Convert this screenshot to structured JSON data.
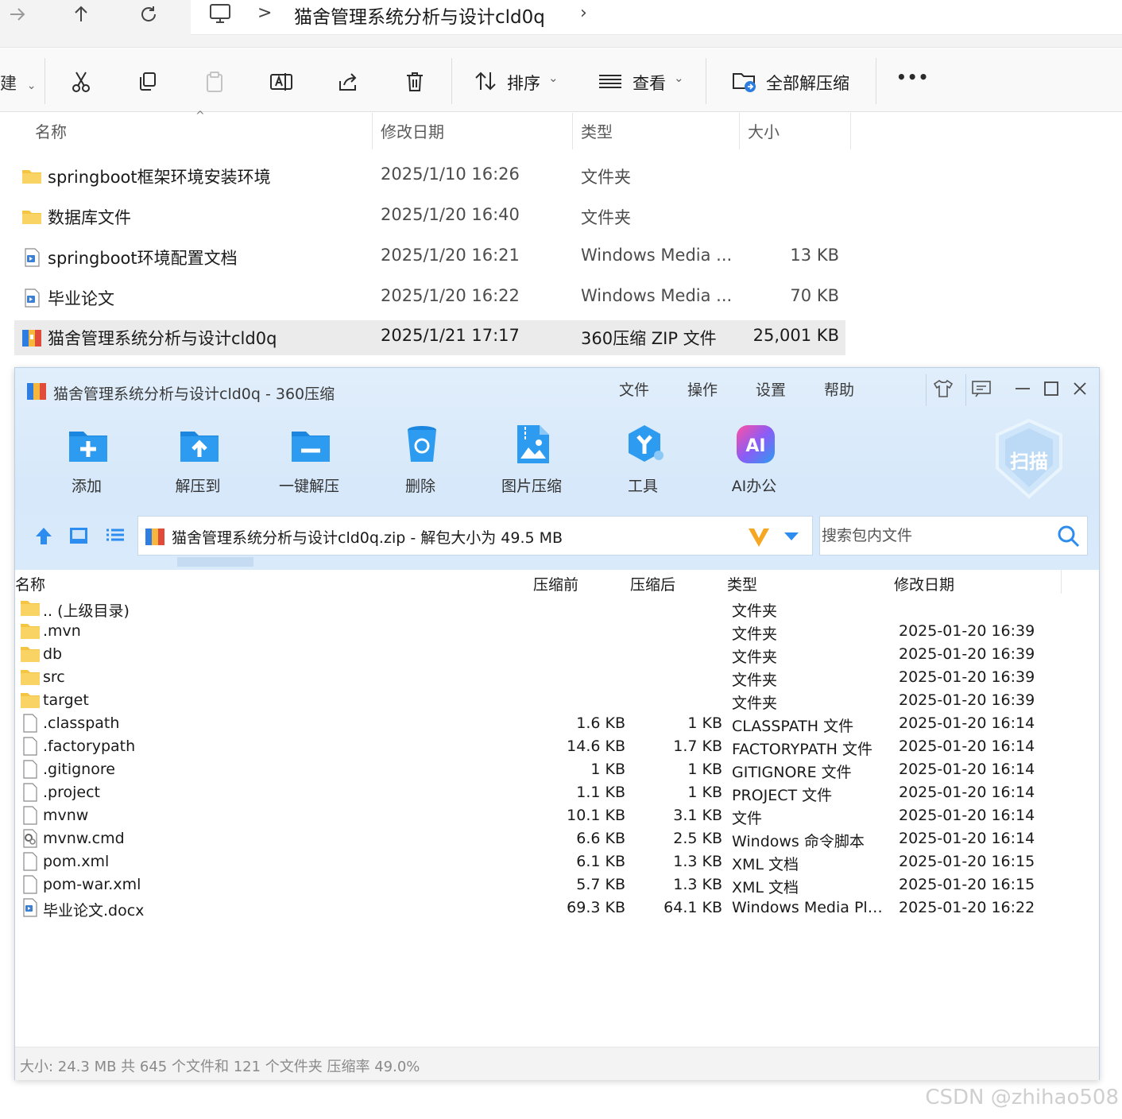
{
  "explorer": {
    "address": {
      "path": "猫舍管理系统分析与设计cld0q",
      "separator": ">",
      "more": "›"
    },
    "toolbar": {
      "new_partial": "建",
      "sort_label": "排序",
      "view_label": "查看",
      "extract_all_label": "全部解压缩",
      "more_label": "•••"
    },
    "columns": {
      "name": "名称",
      "date": "修改日期",
      "type": "类型",
      "size": "大小"
    },
    "rows": [
      {
        "name": "springboot框架环境安装环境",
        "date": "2025/1/10 16:26",
        "type": "文件夹",
        "size": "",
        "icon": "folder-icon"
      },
      {
        "name": "数据库文件",
        "date": "2025/1/20 16:40",
        "type": "文件夹",
        "size": "",
        "icon": "folder-icon"
      },
      {
        "name": "springboot环境配置文档",
        "date": "2025/1/20 16:21",
        "type": "Windows Media ...",
        "size": "13 KB",
        "icon": "document-icon"
      },
      {
        "name": "毕业论文",
        "date": "2025/1/20 16:22",
        "type": "Windows Media ...",
        "size": "70 KB",
        "icon": "document-icon"
      },
      {
        "name": "猫舍管理系统分析与设计cld0q",
        "date": "2025/1/21 17:17",
        "type": "360压缩 ZIP 文件",
        "size": "25,001 KB",
        "icon": "zip-archive-icon",
        "selected": true
      }
    ]
  },
  "zip": {
    "title": "猫舍管理系统分析与设计cld0q - 360压缩",
    "menu": [
      "文件",
      "操作",
      "设置",
      "帮助"
    ],
    "tools": [
      {
        "label": "添加",
        "icon": "add-folder-icon"
      },
      {
        "label": "解压到",
        "icon": "extract-folder-icon"
      },
      {
        "label": "一键解压",
        "icon": "one-click-extract-icon"
      },
      {
        "label": "删除",
        "icon": "recycle-bin-icon"
      },
      {
        "label": "图片压缩",
        "icon": "image-compress-icon"
      },
      {
        "label": "工具",
        "icon": "tools-icon"
      },
      {
        "label": "AI办公",
        "icon": "ai-office-icon"
      }
    ],
    "scan_label": "扫描",
    "path": "猫舍管理系统分析与设计cld0q.zip - 解包大小为 49.5 MB",
    "search_placeholder": "搜索包内文件",
    "columns": {
      "name": "名称",
      "before": "压缩前",
      "after": "压缩后",
      "type": "类型",
      "date": "修改日期"
    },
    "rows": [
      {
        "name": ".. (上级目录)",
        "before": "",
        "after": "",
        "type": "文件夹",
        "date": "",
        "icon": "folder-icon"
      },
      {
        "name": ".mvn",
        "before": "",
        "after": "",
        "type": "文件夹",
        "date": "2025-01-20 16:39",
        "icon": "folder-icon"
      },
      {
        "name": "db",
        "before": "",
        "after": "",
        "type": "文件夹",
        "date": "2025-01-20 16:39",
        "icon": "folder-icon"
      },
      {
        "name": "src",
        "before": "",
        "after": "",
        "type": "文件夹",
        "date": "2025-01-20 16:39",
        "icon": "folder-icon"
      },
      {
        "name": "target",
        "before": "",
        "after": "",
        "type": "文件夹",
        "date": "2025-01-20 16:39",
        "icon": "folder-icon"
      },
      {
        "name": ".classpath",
        "before": "1.6 KB",
        "after": "1 KB",
        "type": "CLASSPATH 文件",
        "date": "2025-01-20 16:14",
        "icon": "file-icon"
      },
      {
        "name": ".factorypath",
        "before": "14.6 KB",
        "after": "1.7 KB",
        "type": "FACTORYPATH 文件",
        "date": "2025-01-20 16:14",
        "icon": "file-icon"
      },
      {
        "name": ".gitignore",
        "before": "1 KB",
        "after": "1 KB",
        "type": "GITIGNORE 文件",
        "date": "2025-01-20 16:14",
        "icon": "file-icon"
      },
      {
        "name": ".project",
        "before": "1.1 KB",
        "after": "1 KB",
        "type": "PROJECT 文件",
        "date": "2025-01-20 16:14",
        "icon": "file-icon"
      },
      {
        "name": "mvnw",
        "before": "10.1 KB",
        "after": "3.1 KB",
        "type": "文件",
        "date": "2025-01-20 16:14",
        "icon": "file-icon"
      },
      {
        "name": "mvnw.cmd",
        "before": "6.6 KB",
        "after": "2.5 KB",
        "type": "Windows 命令脚本",
        "date": "2025-01-20 16:14",
        "icon": "script-gear-icon"
      },
      {
        "name": "pom.xml",
        "before": "6.1 KB",
        "after": "1.3 KB",
        "type": "XML 文档",
        "date": "2025-01-20 16:15",
        "icon": "file-icon"
      },
      {
        "name": "pom-war.xml",
        "before": "5.7 KB",
        "after": "1.3 KB",
        "type": "XML 文档",
        "date": "2025-01-20 16:15",
        "icon": "file-icon"
      },
      {
        "name": "毕业论文.docx",
        "before": "69.3 KB",
        "after": "64.1 KB",
        "type": "Windows Media Pla...",
        "date": "2025-01-20 16:22",
        "icon": "document-icon"
      }
    ],
    "status": "大小: 24.3 MB 共 645 个文件和 121 个文件夹 压缩率 49.0%"
  },
  "watermark": "CSDN @zhihao508",
  "colors": {
    "folder": "#f4c542",
    "accent_blue": "#2d8cf0",
    "zip_header": "#d6e8fa",
    "selected_row": "#ebebeb"
  }
}
